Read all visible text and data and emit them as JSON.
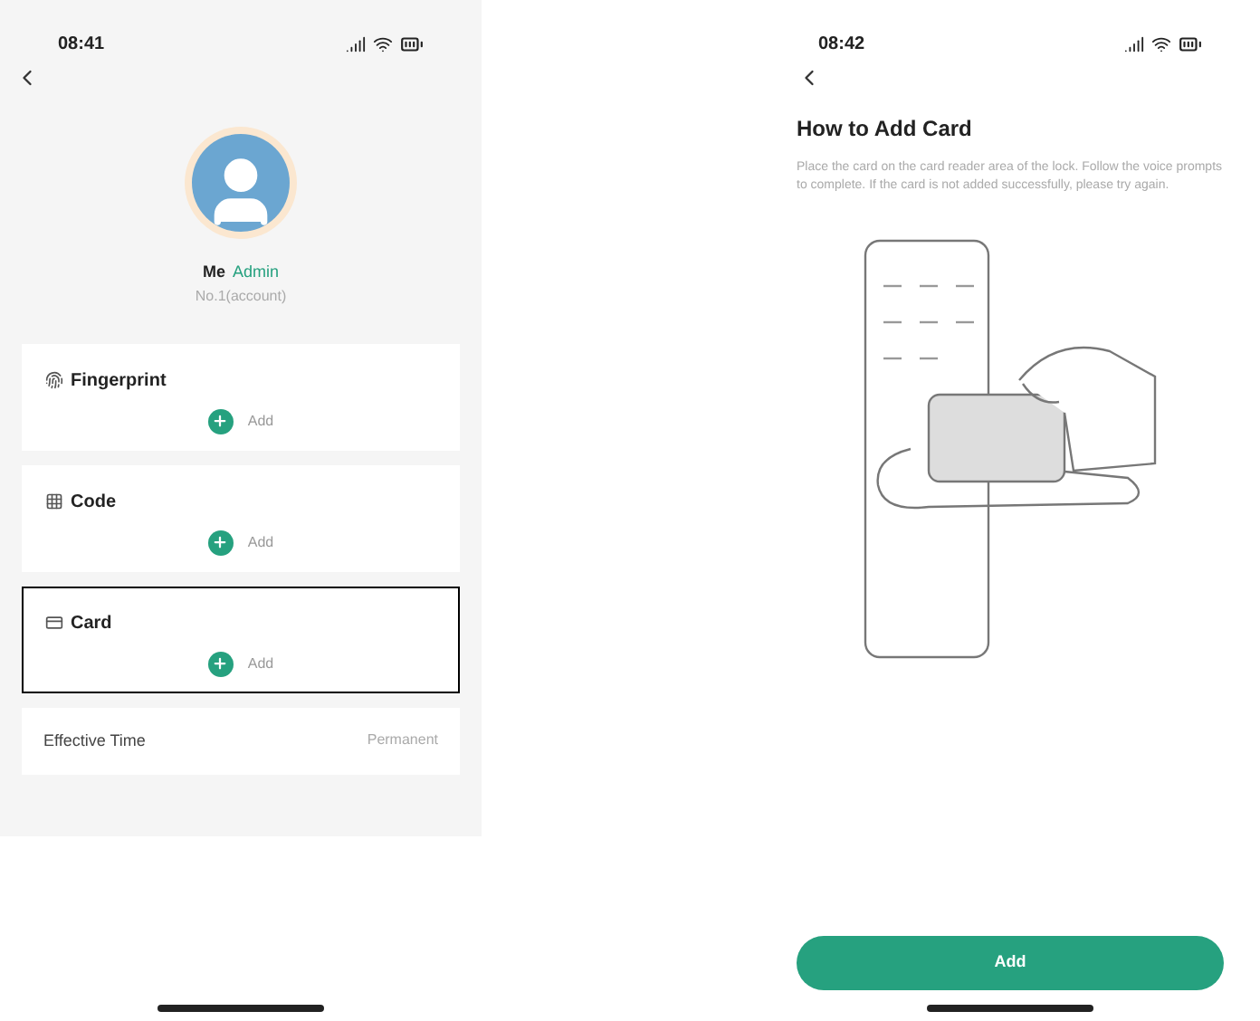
{
  "member_screen": {
    "status_bar": {
      "time": "08:41"
    },
    "profile": {
      "name": "Me",
      "role": "Admin",
      "subtitle": "No.1(account)"
    },
    "credentials": [
      {
        "kind": "fingerprint",
        "label": "Fingerprint",
        "action": "Add",
        "highlighted": false
      },
      {
        "kind": "code",
        "label": "Code",
        "action": "Add",
        "highlighted": false
      },
      {
        "kind": "card",
        "label": "Card",
        "action": "Add",
        "highlighted": true
      }
    ],
    "effective_time": {
      "label": "Effective Time",
      "value": "Permanent"
    }
  },
  "guide_screen": {
    "status_bar": {
      "time": "08:42"
    },
    "title": "How to Add Card",
    "description": "Place the card on the card reader area of the lock. Follow the voice prompts to complete. If the card is not added successfully, please try again.",
    "button": "Add"
  }
}
